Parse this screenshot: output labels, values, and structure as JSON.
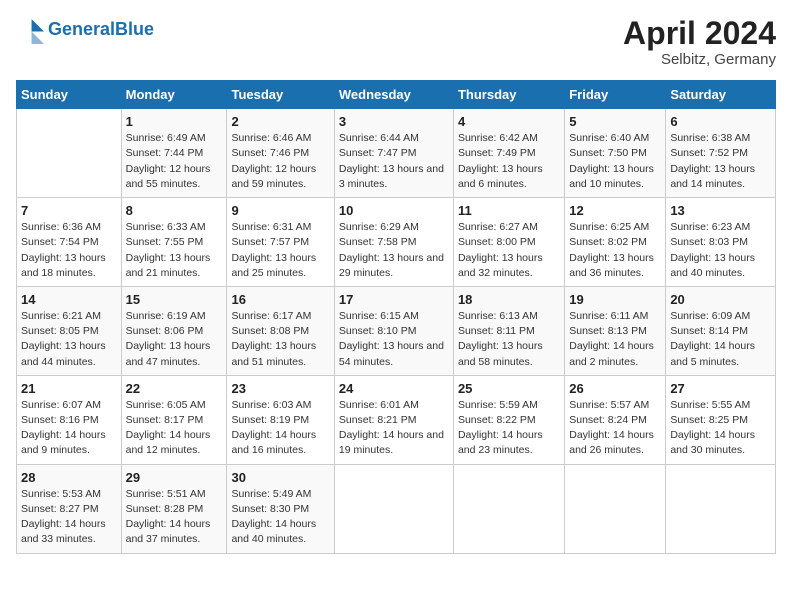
{
  "header": {
    "logo_general": "General",
    "logo_blue": "Blue",
    "title": "April 2024",
    "subtitle": "Selbitz, Germany"
  },
  "days_of_week": [
    "Sunday",
    "Monday",
    "Tuesday",
    "Wednesday",
    "Thursday",
    "Friday",
    "Saturday"
  ],
  "weeks": [
    [
      {
        "day": "",
        "sunrise": "",
        "sunset": "",
        "daylight": ""
      },
      {
        "day": "1",
        "sunrise": "Sunrise: 6:49 AM",
        "sunset": "Sunset: 7:44 PM",
        "daylight": "Daylight: 12 hours and 55 minutes."
      },
      {
        "day": "2",
        "sunrise": "Sunrise: 6:46 AM",
        "sunset": "Sunset: 7:46 PM",
        "daylight": "Daylight: 12 hours and 59 minutes."
      },
      {
        "day": "3",
        "sunrise": "Sunrise: 6:44 AM",
        "sunset": "Sunset: 7:47 PM",
        "daylight": "Daylight: 13 hours and 3 minutes."
      },
      {
        "day": "4",
        "sunrise": "Sunrise: 6:42 AM",
        "sunset": "Sunset: 7:49 PM",
        "daylight": "Daylight: 13 hours and 6 minutes."
      },
      {
        "day": "5",
        "sunrise": "Sunrise: 6:40 AM",
        "sunset": "Sunset: 7:50 PM",
        "daylight": "Daylight: 13 hours and 10 minutes."
      },
      {
        "day": "6",
        "sunrise": "Sunrise: 6:38 AM",
        "sunset": "Sunset: 7:52 PM",
        "daylight": "Daylight: 13 hours and 14 minutes."
      }
    ],
    [
      {
        "day": "7",
        "sunrise": "Sunrise: 6:36 AM",
        "sunset": "Sunset: 7:54 PM",
        "daylight": "Daylight: 13 hours and 18 minutes."
      },
      {
        "day": "8",
        "sunrise": "Sunrise: 6:33 AM",
        "sunset": "Sunset: 7:55 PM",
        "daylight": "Daylight: 13 hours and 21 minutes."
      },
      {
        "day": "9",
        "sunrise": "Sunrise: 6:31 AM",
        "sunset": "Sunset: 7:57 PM",
        "daylight": "Daylight: 13 hours and 25 minutes."
      },
      {
        "day": "10",
        "sunrise": "Sunrise: 6:29 AM",
        "sunset": "Sunset: 7:58 PM",
        "daylight": "Daylight: 13 hours and 29 minutes."
      },
      {
        "day": "11",
        "sunrise": "Sunrise: 6:27 AM",
        "sunset": "Sunset: 8:00 PM",
        "daylight": "Daylight: 13 hours and 32 minutes."
      },
      {
        "day": "12",
        "sunrise": "Sunrise: 6:25 AM",
        "sunset": "Sunset: 8:02 PM",
        "daylight": "Daylight: 13 hours and 36 minutes."
      },
      {
        "day": "13",
        "sunrise": "Sunrise: 6:23 AM",
        "sunset": "Sunset: 8:03 PM",
        "daylight": "Daylight: 13 hours and 40 minutes."
      }
    ],
    [
      {
        "day": "14",
        "sunrise": "Sunrise: 6:21 AM",
        "sunset": "Sunset: 8:05 PM",
        "daylight": "Daylight: 13 hours and 44 minutes."
      },
      {
        "day": "15",
        "sunrise": "Sunrise: 6:19 AM",
        "sunset": "Sunset: 8:06 PM",
        "daylight": "Daylight: 13 hours and 47 minutes."
      },
      {
        "day": "16",
        "sunrise": "Sunrise: 6:17 AM",
        "sunset": "Sunset: 8:08 PM",
        "daylight": "Daylight: 13 hours and 51 minutes."
      },
      {
        "day": "17",
        "sunrise": "Sunrise: 6:15 AM",
        "sunset": "Sunset: 8:10 PM",
        "daylight": "Daylight: 13 hours and 54 minutes."
      },
      {
        "day": "18",
        "sunrise": "Sunrise: 6:13 AM",
        "sunset": "Sunset: 8:11 PM",
        "daylight": "Daylight: 13 hours and 58 minutes."
      },
      {
        "day": "19",
        "sunrise": "Sunrise: 6:11 AM",
        "sunset": "Sunset: 8:13 PM",
        "daylight": "Daylight: 14 hours and 2 minutes."
      },
      {
        "day": "20",
        "sunrise": "Sunrise: 6:09 AM",
        "sunset": "Sunset: 8:14 PM",
        "daylight": "Daylight: 14 hours and 5 minutes."
      }
    ],
    [
      {
        "day": "21",
        "sunrise": "Sunrise: 6:07 AM",
        "sunset": "Sunset: 8:16 PM",
        "daylight": "Daylight: 14 hours and 9 minutes."
      },
      {
        "day": "22",
        "sunrise": "Sunrise: 6:05 AM",
        "sunset": "Sunset: 8:17 PM",
        "daylight": "Daylight: 14 hours and 12 minutes."
      },
      {
        "day": "23",
        "sunrise": "Sunrise: 6:03 AM",
        "sunset": "Sunset: 8:19 PM",
        "daylight": "Daylight: 14 hours and 16 minutes."
      },
      {
        "day": "24",
        "sunrise": "Sunrise: 6:01 AM",
        "sunset": "Sunset: 8:21 PM",
        "daylight": "Daylight: 14 hours and 19 minutes."
      },
      {
        "day": "25",
        "sunrise": "Sunrise: 5:59 AM",
        "sunset": "Sunset: 8:22 PM",
        "daylight": "Daylight: 14 hours and 23 minutes."
      },
      {
        "day": "26",
        "sunrise": "Sunrise: 5:57 AM",
        "sunset": "Sunset: 8:24 PM",
        "daylight": "Daylight: 14 hours and 26 minutes."
      },
      {
        "day": "27",
        "sunrise": "Sunrise: 5:55 AM",
        "sunset": "Sunset: 8:25 PM",
        "daylight": "Daylight: 14 hours and 30 minutes."
      }
    ],
    [
      {
        "day": "28",
        "sunrise": "Sunrise: 5:53 AM",
        "sunset": "Sunset: 8:27 PM",
        "daylight": "Daylight: 14 hours and 33 minutes."
      },
      {
        "day": "29",
        "sunrise": "Sunrise: 5:51 AM",
        "sunset": "Sunset: 8:28 PM",
        "daylight": "Daylight: 14 hours and 37 minutes."
      },
      {
        "day": "30",
        "sunrise": "Sunrise: 5:49 AM",
        "sunset": "Sunset: 8:30 PM",
        "daylight": "Daylight: 14 hours and 40 minutes."
      },
      {
        "day": "",
        "sunrise": "",
        "sunset": "",
        "daylight": ""
      },
      {
        "day": "",
        "sunrise": "",
        "sunset": "",
        "daylight": ""
      },
      {
        "day": "",
        "sunrise": "",
        "sunset": "",
        "daylight": ""
      },
      {
        "day": "",
        "sunrise": "",
        "sunset": "",
        "daylight": ""
      }
    ]
  ]
}
